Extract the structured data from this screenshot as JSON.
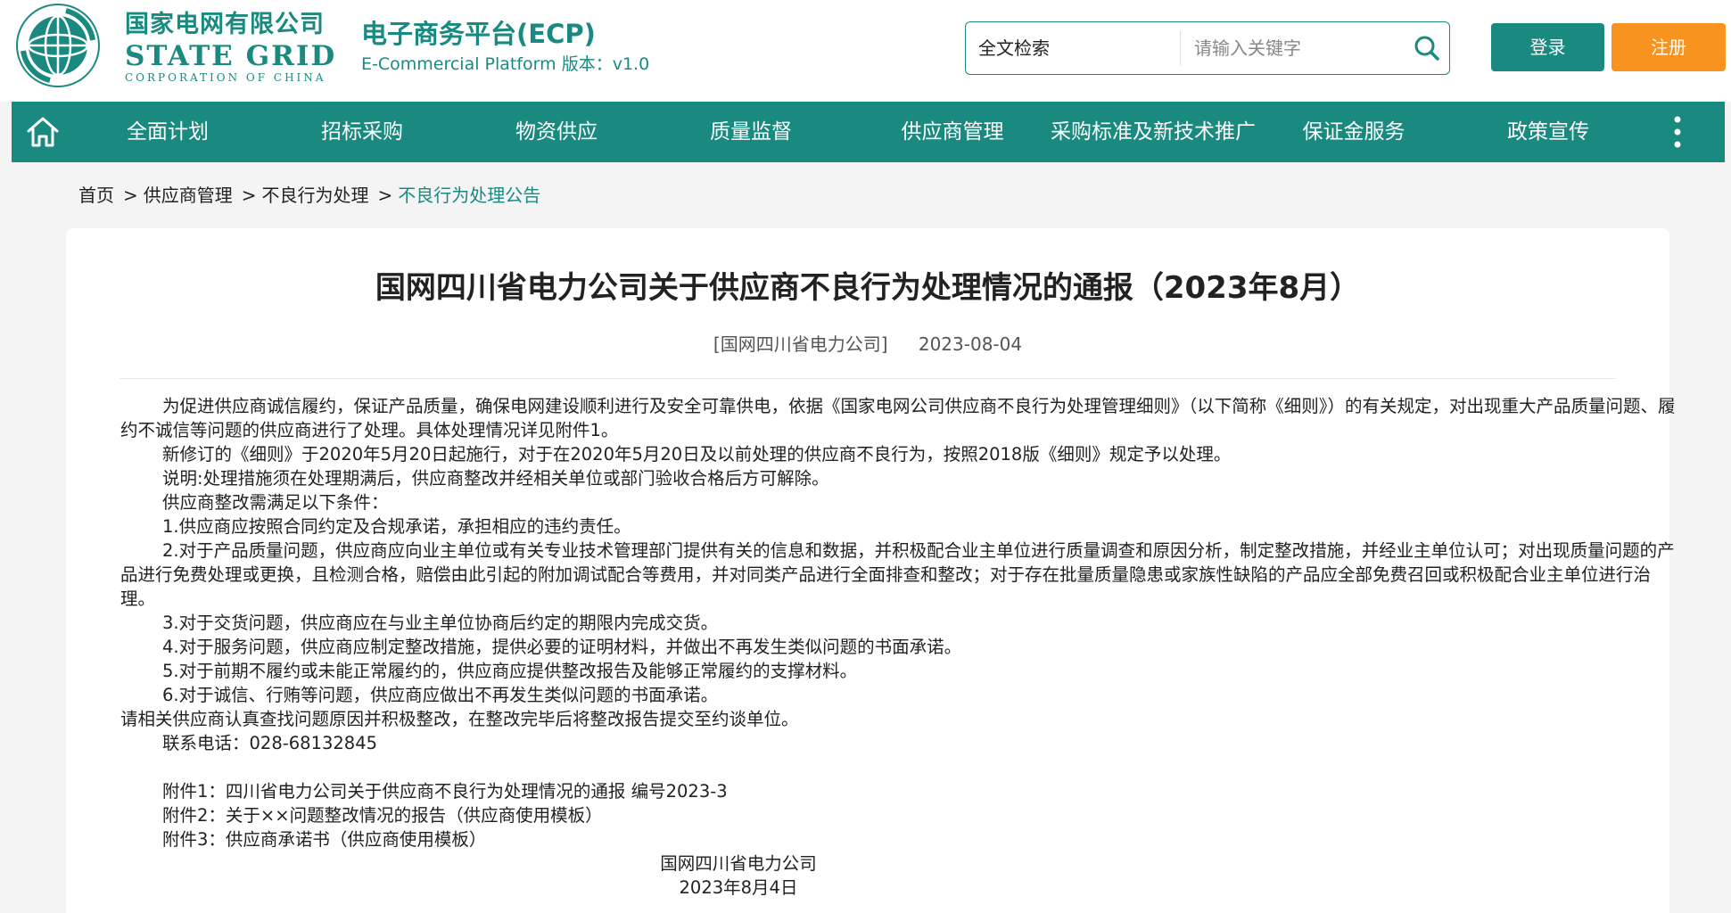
{
  "header": {
    "logo_cn": "国家电网有限公司",
    "logo_en1": "STATE GRID",
    "logo_en2": "CORPORATION OF CHINA",
    "platform_title": "电子商务平台(ECP)",
    "platform_subtitle": "E-Commercial Platform 版本：v1.0",
    "search": {
      "scope": "全文检索",
      "placeholder": "请输入关键字"
    },
    "login_label": "登录",
    "register_label": "注册"
  },
  "nav": {
    "items": [
      {
        "label": "全面计划"
      },
      {
        "label": "招标采购"
      },
      {
        "label": "物资供应"
      },
      {
        "label": "质量监督"
      },
      {
        "label": "供应商管理"
      },
      {
        "label": "采购标准及新技术推广"
      },
      {
        "label": "保证金服务"
      },
      {
        "label": "政策宣传"
      }
    ]
  },
  "breadcrumb": {
    "items": [
      "首页",
      "供应商管理",
      "不良行为处理"
    ],
    "separator": ">",
    "current": "不良行为处理公告"
  },
  "article": {
    "title": "国网四川省电力公司关于供应商不良行为处理情况的通报（2023年8月）",
    "source": "[国网四川省电力公司]",
    "date": "2023-08-04",
    "paragraphs": [
      "为促进供应商诚信履约，保证产品质量，确保电网建设顺利进行及安全可靠供电，依据《国家电网公司供应商不良行为处理管理细则》（以下简称《细则》）的有关规定，对出现重大产品质量问题、履约不诚信等问题的供应商进行了处理。具体处理情况详见附件1。",
      "新修订的《细则》于2020年5月20日起施行，对于在2020年5月20日及以前处理的供应商不良行为，按照2018版《细则》规定予以处理。",
      "说明:处理措施须在处理期满后，供应商整改并经相关单位或部门验收合格后方可解除。",
      "供应商整改需满足以下条件：",
      "1.供应商应按照合同约定及合规承诺，承担相应的违约责任。",
      "2.对于产品质量问题，供应商应向业主单位或有关专业技术管理部门提供有关的信息和数据，并积极配合业主单位进行质量调查和原因分析，制定整改措施，并经业主单位认可；对出现质量问题的产品进行免费处理或更换，且检测合格，赔偿由此引起的附加调试配合等费用，并对同类产品进行全面排查和整改；对于存在批量质量隐患或家族性缺陷的产品应全部免费召回或积极配合业主单位进行治理。",
      "3.对于交货问题，供应商应在与业主单位协商后约定的期限内完成交货。",
      "4.对于服务问题，供应商应制定整改措施，提供必要的证明材料，并做出不再发生类似问题的书面承诺。",
      "5.对于前期不履约或未能正常履约的，供应商应提供整改报告及能够正常履约的支撑材料。",
      "6.对于诚信、行贿等问题，供应商应做出不再发生类似问题的书面承诺。"
    ],
    "closing": "请相关供应商认真查找问题原因并积极整改，在整改完毕后将整改报告提交至约谈单位。",
    "contact": "联系电话：028-68132845",
    "attachments": [
      "附件1：四川省电力公司关于供应商不良行为处理情况的通报 编号2023-3",
      "附件2：关于××问题整改情况的报告（供应商使用模板）",
      "附件3：供应商承诺书（供应商使用模板）"
    ],
    "signature_org": "国网四川省电力公司",
    "signature_date": "2023年8月4日"
  },
  "colors": {
    "brand_green": "#1a8a80",
    "register_orange": "#f7931e"
  }
}
